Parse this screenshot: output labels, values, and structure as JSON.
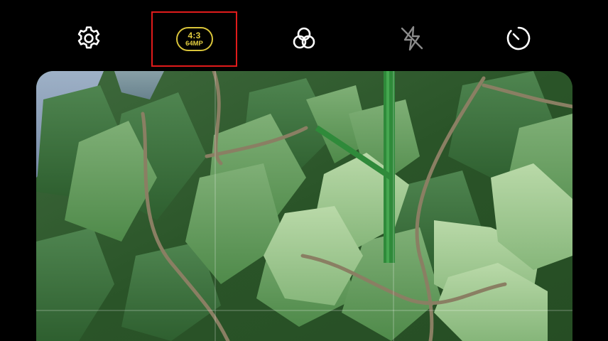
{
  "toolbar": {
    "settings_icon": "gear-icon",
    "aspect_ratio": {
      "ratio": "4:3",
      "resolution": "64MP",
      "color": "#e2cd3f",
      "highlight_color": "#e01b1b"
    },
    "filters_icon": "filters-icon",
    "flash_icon": "flash-off-icon",
    "timer_icon": "timer-icon"
  },
  "viewfinder": {
    "grid": "3x3"
  }
}
